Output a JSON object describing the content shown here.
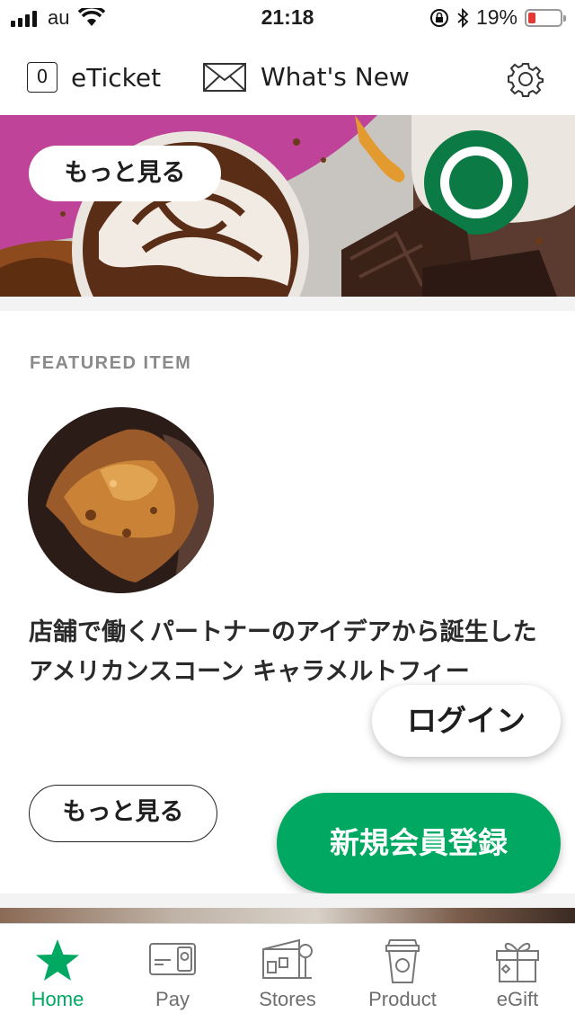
{
  "status_bar": {
    "carrier": "au",
    "time": "21:18",
    "battery_percent": "19%",
    "battery_level": 0.19,
    "icons": [
      "signal-icon",
      "wifi-icon",
      "orientation-lock-icon",
      "bluetooth-icon",
      "battery-icon"
    ]
  },
  "top_nav": {
    "eticket_count": "0",
    "eticket_label": "eTicket",
    "whats_new_label": "What's New",
    "icons": [
      "mail-icon",
      "gear-icon"
    ]
  },
  "hero": {
    "more_label": "もっと見る"
  },
  "featured": {
    "heading": "FEATURED ITEM",
    "title": "店舗で働くパートナーのアイデアから誕生したアメリカンスコーン キャラメルトフィー",
    "more_label": "もっと見る"
  },
  "floating": {
    "login_label": "ログイン",
    "join_label": "新規会員登録"
  },
  "tabs": [
    {
      "label": "Home",
      "icon": "star-icon",
      "active": true
    },
    {
      "label": "Pay",
      "icon": "card-icon",
      "active": false
    },
    {
      "label": "Stores",
      "icon": "store-icon",
      "active": false
    },
    {
      "label": "Product",
      "icon": "cup-icon",
      "active": false
    },
    {
      "label": "eGift",
      "icon": "gift-icon",
      "active": false
    }
  ],
  "colors": {
    "brand_green": "#00a862",
    "battery_low": "#e53935"
  }
}
